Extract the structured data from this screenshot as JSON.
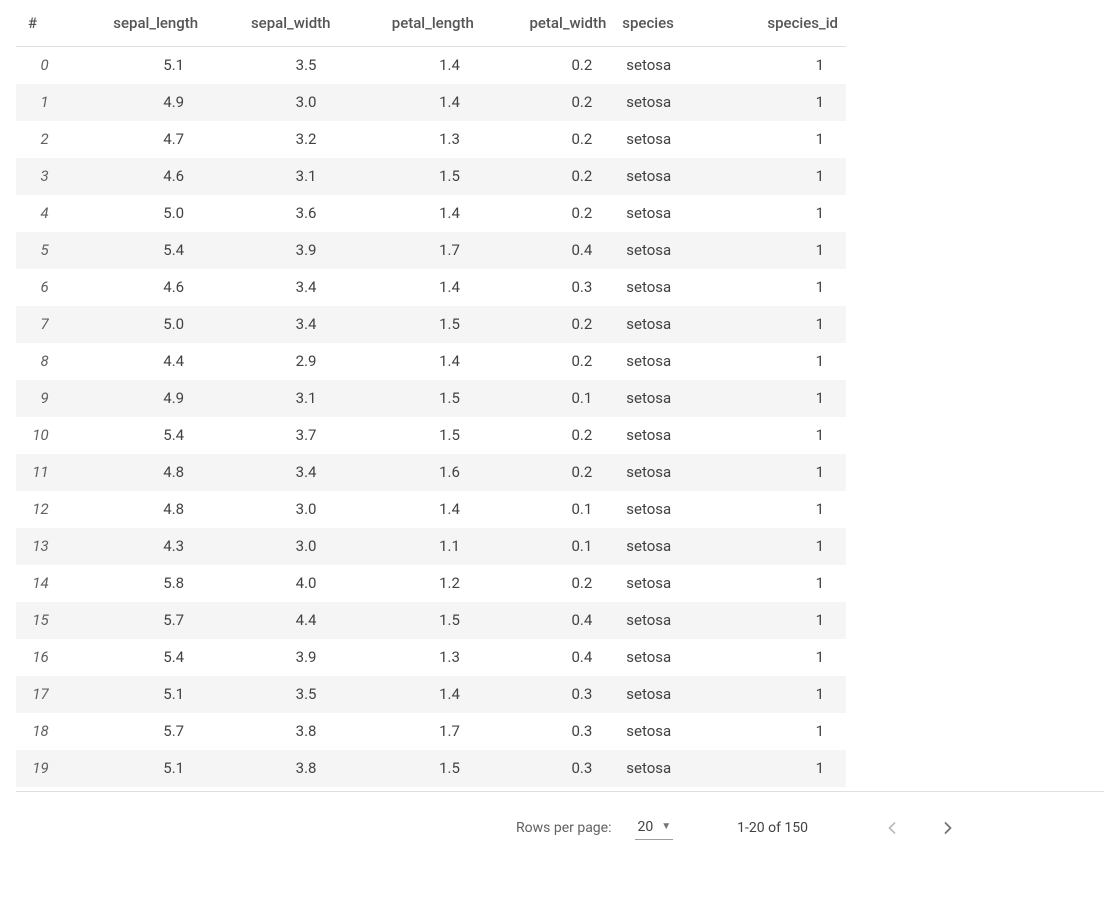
{
  "table": {
    "index_header": "#",
    "columns": [
      {
        "key": "sepal_length",
        "label": "sepal_length",
        "type": "num"
      },
      {
        "key": "sepal_width",
        "label": "sepal_width",
        "type": "num"
      },
      {
        "key": "petal_length",
        "label": "petal_length",
        "type": "num"
      },
      {
        "key": "petal_width",
        "label": "petal_width",
        "type": "num"
      },
      {
        "key": "species",
        "label": "species",
        "type": "str"
      },
      {
        "key": "species_id",
        "label": "species_id",
        "type": "num"
      }
    ],
    "rows": [
      {
        "idx": 0,
        "sepal_length": "5.1",
        "sepal_width": "3.5",
        "petal_length": "1.4",
        "petal_width": "0.2",
        "species": "setosa",
        "species_id": "1"
      },
      {
        "idx": 1,
        "sepal_length": "4.9",
        "sepal_width": "3.0",
        "petal_length": "1.4",
        "petal_width": "0.2",
        "species": "setosa",
        "species_id": "1"
      },
      {
        "idx": 2,
        "sepal_length": "4.7",
        "sepal_width": "3.2",
        "petal_length": "1.3",
        "petal_width": "0.2",
        "species": "setosa",
        "species_id": "1"
      },
      {
        "idx": 3,
        "sepal_length": "4.6",
        "sepal_width": "3.1",
        "petal_length": "1.5",
        "petal_width": "0.2",
        "species": "setosa",
        "species_id": "1"
      },
      {
        "idx": 4,
        "sepal_length": "5.0",
        "sepal_width": "3.6",
        "petal_length": "1.4",
        "petal_width": "0.2",
        "species": "setosa",
        "species_id": "1"
      },
      {
        "idx": 5,
        "sepal_length": "5.4",
        "sepal_width": "3.9",
        "petal_length": "1.7",
        "petal_width": "0.4",
        "species": "setosa",
        "species_id": "1"
      },
      {
        "idx": 6,
        "sepal_length": "4.6",
        "sepal_width": "3.4",
        "petal_length": "1.4",
        "petal_width": "0.3",
        "species": "setosa",
        "species_id": "1"
      },
      {
        "idx": 7,
        "sepal_length": "5.0",
        "sepal_width": "3.4",
        "petal_length": "1.5",
        "petal_width": "0.2",
        "species": "setosa",
        "species_id": "1"
      },
      {
        "idx": 8,
        "sepal_length": "4.4",
        "sepal_width": "2.9",
        "petal_length": "1.4",
        "petal_width": "0.2",
        "species": "setosa",
        "species_id": "1"
      },
      {
        "idx": 9,
        "sepal_length": "4.9",
        "sepal_width": "3.1",
        "petal_length": "1.5",
        "petal_width": "0.1",
        "species": "setosa",
        "species_id": "1"
      },
      {
        "idx": 10,
        "sepal_length": "5.4",
        "sepal_width": "3.7",
        "petal_length": "1.5",
        "petal_width": "0.2",
        "species": "setosa",
        "species_id": "1"
      },
      {
        "idx": 11,
        "sepal_length": "4.8",
        "sepal_width": "3.4",
        "petal_length": "1.6",
        "petal_width": "0.2",
        "species": "setosa",
        "species_id": "1"
      },
      {
        "idx": 12,
        "sepal_length": "4.8",
        "sepal_width": "3.0",
        "petal_length": "1.4",
        "petal_width": "0.1",
        "species": "setosa",
        "species_id": "1"
      },
      {
        "idx": 13,
        "sepal_length": "4.3",
        "sepal_width": "3.0",
        "petal_length": "1.1",
        "petal_width": "0.1",
        "species": "setosa",
        "species_id": "1"
      },
      {
        "idx": 14,
        "sepal_length": "5.8",
        "sepal_width": "4.0",
        "petal_length": "1.2",
        "petal_width": "0.2",
        "species": "setosa",
        "species_id": "1"
      },
      {
        "idx": 15,
        "sepal_length": "5.7",
        "sepal_width": "4.4",
        "petal_length": "1.5",
        "petal_width": "0.4",
        "species": "setosa",
        "species_id": "1"
      },
      {
        "idx": 16,
        "sepal_length": "5.4",
        "sepal_width": "3.9",
        "petal_length": "1.3",
        "petal_width": "0.4",
        "species": "setosa",
        "species_id": "1"
      },
      {
        "idx": 17,
        "sepal_length": "5.1",
        "sepal_width": "3.5",
        "petal_length": "1.4",
        "petal_width": "0.3",
        "species": "setosa",
        "species_id": "1"
      },
      {
        "idx": 18,
        "sepal_length": "5.7",
        "sepal_width": "3.8",
        "petal_length": "1.7",
        "petal_width": "0.3",
        "species": "setosa",
        "species_id": "1"
      },
      {
        "idx": 19,
        "sepal_length": "5.1",
        "sepal_width": "3.8",
        "petal_length": "1.5",
        "petal_width": "0.3",
        "species": "setosa",
        "species_id": "1"
      }
    ]
  },
  "pagination": {
    "rows_per_page_label": "Rows per page:",
    "rows_per_page_value": "20",
    "range_text": "1-20 of 150",
    "prev_enabled": false,
    "next_enabled": true
  }
}
